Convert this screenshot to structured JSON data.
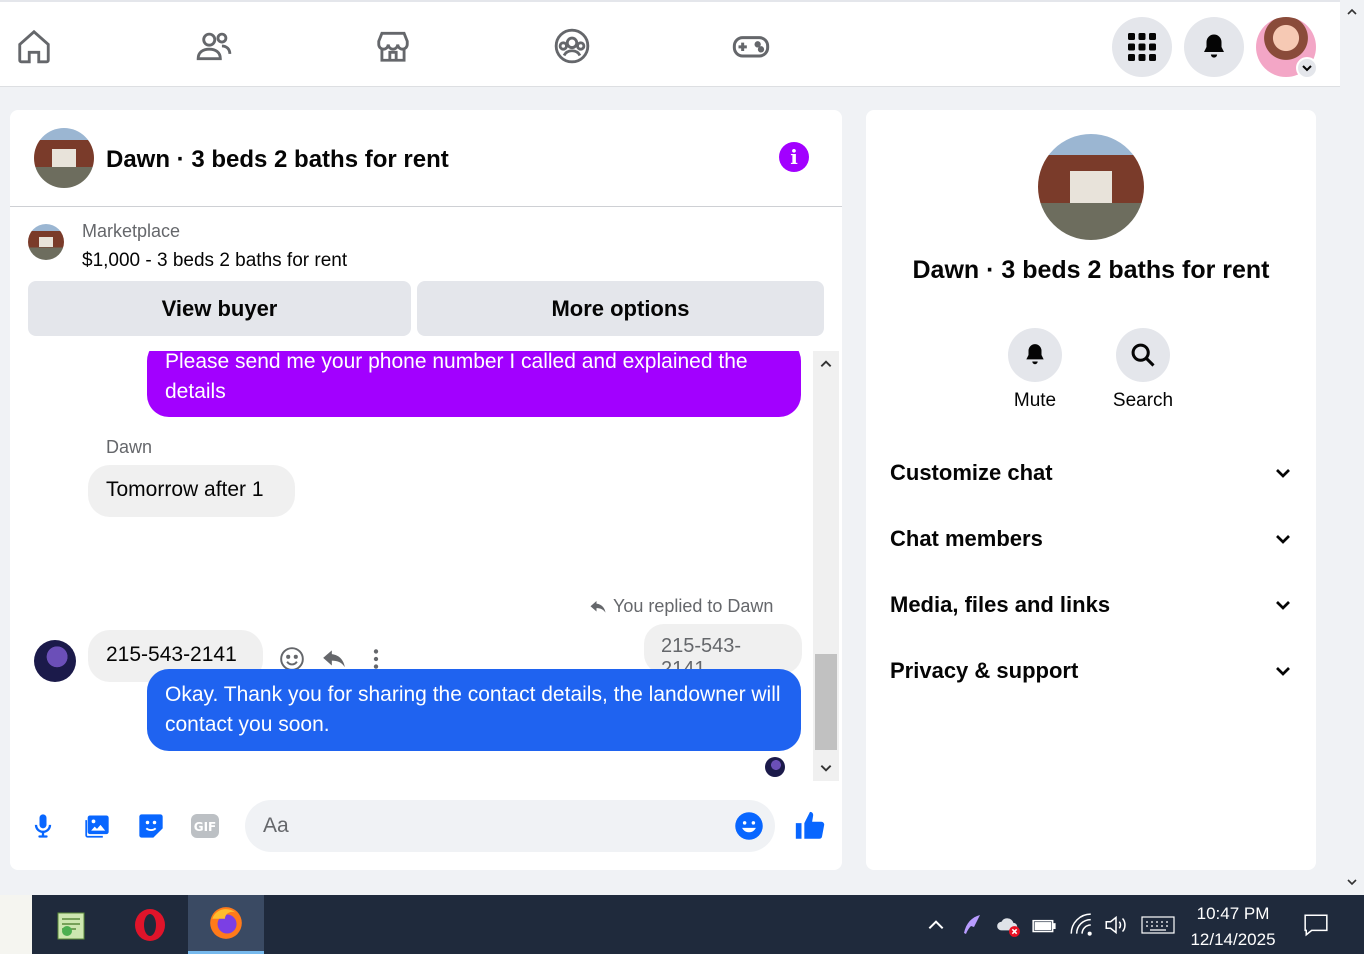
{
  "chat": {
    "title": "Dawn · 3 beds 2 baths for rent",
    "marketplace_label": "Marketplace",
    "listing": "$1,000 - 3 beds 2 baths for rent",
    "view_buyer_label": "View buyer",
    "more_options_label": "More options",
    "messages": {
      "outgoing_1": "Please send me your phone number I called and explained the details",
      "sender_name": "Dawn",
      "incoming_1": "Tomorrow after 1",
      "incoming_2": "215-543-2141",
      "reply_note": "You replied to Dawn",
      "replied_quote": "215-543-2141",
      "outgoing_2": "Okay. Thank you for sharing the contact details, the landowner will contact you soon."
    },
    "composer_placeholder": "Aa"
  },
  "panel": {
    "title": "Dawn · 3 beds 2 baths for rent",
    "mute_label": "Mute",
    "search_label": "Search",
    "sections": [
      "Customize chat",
      "Chat members",
      "Media, files and links",
      "Privacy & support"
    ]
  },
  "taskbar": {
    "time": "10:47 PM",
    "date": "12/14/2025"
  },
  "colors": {
    "accent_purple": "#a200ff",
    "accent_blue": "#1f63f0",
    "messenger_blue": "#0866ff"
  }
}
